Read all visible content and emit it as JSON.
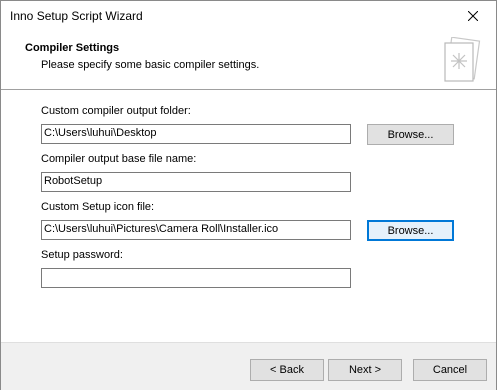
{
  "window": {
    "title": "Inno Setup Script Wizard"
  },
  "header": {
    "title": "Compiler Settings",
    "subtitle": "Please specify some basic compiler settings."
  },
  "form": {
    "output_folder_label": "Custom compiler output folder:",
    "output_folder_value": "C:\\Users\\luhui\\Desktop",
    "output_folder_browse": "Browse...",
    "base_name_label": "Compiler output base file name:",
    "base_name_value": "RobotSetup",
    "icon_label": "Custom Setup icon file:",
    "icon_value": "C:\\Users\\luhui\\Pictures\\Camera Roll\\Installer.ico",
    "icon_browse": "Browse...",
    "password_label": "Setup password:",
    "password_value": ""
  },
  "footer": {
    "back": "< Back",
    "next": "Next >",
    "cancel": "Cancel"
  },
  "icons": {
    "close": "close-icon",
    "wizard": "document-star-icon"
  }
}
